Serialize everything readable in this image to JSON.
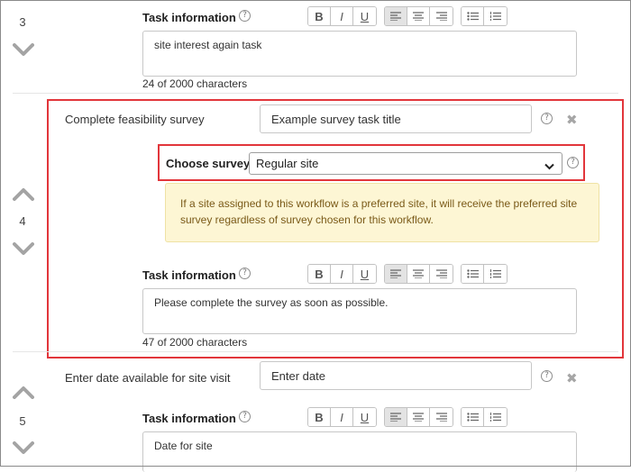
{
  "steps": {
    "step3": {
      "number": "3",
      "task_info_label": "Task information",
      "description": "site interest again task",
      "char_count": "24 of 2000 characters"
    },
    "step4": {
      "number": "4",
      "task_name": "Complete feasibility survey",
      "title_placeholder": "Example survey task title",
      "choose_survey_label": "Choose survey:",
      "survey_selected": "Regular site",
      "note": "If a site assigned to this workflow is a preferred site, it will receive the preferred site survey regardless of survey chosen for this workflow.",
      "task_info_label": "Task information",
      "description": "Please complete the survey as soon as possible.",
      "char_count": "47 of 2000 characters"
    },
    "step5": {
      "number": "5",
      "task_name": "Enter date available for site visit",
      "title_placeholder": "Enter date",
      "task_info_label": "Task information",
      "description": "Date for site"
    }
  },
  "toolbar": {
    "bold": "B",
    "italic": "I",
    "underline": "U"
  },
  "icons": {
    "help": "?",
    "remove": "✖"
  },
  "colors": {
    "highlight_border": "#e2363b",
    "note_background": "#fdf6d4",
    "note_text": "#7a5a18"
  }
}
